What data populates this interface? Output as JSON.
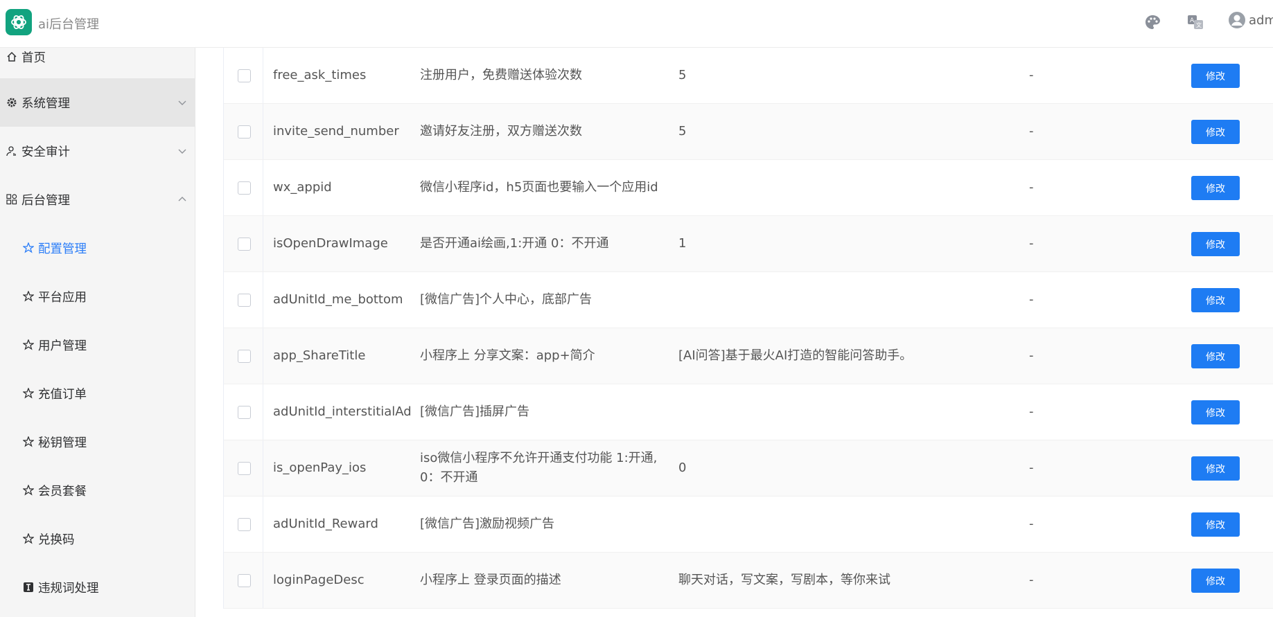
{
  "app": {
    "title": "ai后台管理",
    "user": "adm"
  },
  "header_icons": [
    "palette-icon",
    "translate-icon",
    "user-avatar-icon"
  ],
  "sidebar": {
    "top_items": [
      {
        "label": "首页",
        "icon": "home-icon"
      },
      {
        "label": "系统管理",
        "icon": "gear-icon"
      },
      {
        "label": "安全审计",
        "icon": "user-audit-icon"
      },
      {
        "label": "后台管理",
        "icon": "grid-icon"
      }
    ],
    "sub_items": [
      {
        "label": "配置管理",
        "icon": "star-icon"
      },
      {
        "label": "平台应用",
        "icon": "star-icon"
      },
      {
        "label": "用户管理",
        "icon": "star-icon"
      },
      {
        "label": "充值订单",
        "icon": "star-icon"
      },
      {
        "label": "秘钥管理",
        "icon": "star-icon"
      },
      {
        "label": "会员套餐",
        "icon": "star-icon"
      },
      {
        "label": "兑换码",
        "icon": "star-icon"
      },
      {
        "label": "违规词处理",
        "icon": "text-icon"
      }
    ]
  },
  "table": {
    "edit_label": "修改",
    "rows": [
      {
        "key": "free_ask_times",
        "desc": "注册用户，免费赠送体验次数",
        "value": "5",
        "dash": "-"
      },
      {
        "key": "invite_send_number",
        "desc": "邀请好友注册，双方赠送次数",
        "value": "5",
        "dash": "-"
      },
      {
        "key": "wx_appid",
        "desc": "微信小程序id，h5页面也要输入一个应用id",
        "value": "",
        "dash": "-"
      },
      {
        "key": "isOpenDrawImage",
        "desc": "是否开通ai绘画,1:开通 0：不开通",
        "value": "1",
        "dash": "-"
      },
      {
        "key": "adUnitId_me_bottom",
        "desc": "[微信广告]个人中心，底部广告",
        "value": "",
        "dash": "-"
      },
      {
        "key": "app_ShareTitle",
        "desc": "小程序上 分享文案：app+简介",
        "value": "[AI问答]基于最火AI打造的智能问答助手。",
        "dash": "-"
      },
      {
        "key": "adUnitId_interstitialAd",
        "desc": "[微信广告]插屏广告",
        "value": "",
        "dash": "-"
      },
      {
        "key": "is_openPay_ios",
        "desc": "iso微信小程序不允许开通支付功能 1:开通, 0：不开通",
        "value": "0",
        "dash": "-"
      },
      {
        "key": "adUnitId_Reward",
        "desc": "[微信广告]激励视频广告",
        "value": "",
        "dash": "-"
      },
      {
        "key": "loginPageDesc",
        "desc": "小程序上 登录页面的描述",
        "value": "聊天对话，写文案，写剧本，等你来试",
        "dash": "-"
      }
    ]
  }
}
